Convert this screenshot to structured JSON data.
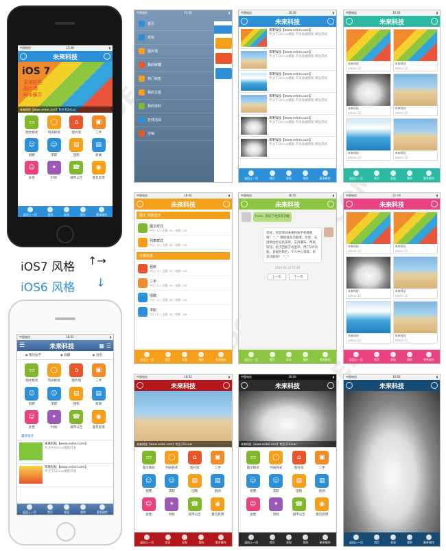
{
  "brand": "未来科技",
  "labels": {
    "ios7": "iOS7 风格",
    "ios6": "iOS6 风格"
  },
  "status": {
    "carrier": "中国电信",
    "t1": "15:48",
    "t2": "11:46",
    "t3": "16:28",
    "t4": "16:02",
    "t5": "16:05",
    "t6": "16:55",
    "t7": "21:19",
    "t8": "16:02",
    "t9": "16:09",
    "t10": "16:27",
    "t11": "16:02",
    "t12": "18:02"
  },
  "banner": {
    "big": "iOS 7",
    "l1": "无限配色",
    "l2": "图片墙",
    "l3": "App展示",
    "caption": "未来科技【www.veikei.com】专注于Discuz"
  },
  "grid": [
    "图文样式",
    "列表样式",
    "图片墙",
    "二手",
    "招聘",
    "求职",
    "团购",
    "新闻",
    "女性",
    "时尚",
    "城市公告",
    "意见反馈"
  ],
  "bottom": [
    "返回上一页",
    "首页",
    "发现",
    "我的",
    "更多操作"
  ],
  "menu": [
    "首页",
    "论坛",
    "图片墙",
    "我的收藏",
    "热门标签",
    "我的主题",
    "我的资料",
    "在线活动",
    "注销"
  ],
  "list": {
    "t": "未来科技【www.veikei.com】",
    "s": "专注于Discuz模板 开发高端模板 精品风格"
  },
  "wall": {
    "tag": "未来科技",
    "small": "admin",
    "num": "12"
  },
  "forum": {
    "sec1": "图文 列表显示",
    "sec2": "分类信息",
    "rows": [
      "图文样式",
      "列表样式",
      "租房",
      "二手",
      "招聘",
      "求职"
    ],
    "meta": "今日: 12 | 主题: 36 | 帖数: 108"
  },
  "chat": {
    "hello": "Hello, 测试了更多新功能",
    "msg": "您好，欢迎测试未来科技手机模板啦！^_^ 模板很多功能哦，比如：支持侧拉栏导航菜单，支持瀑布，帮助按钮，帖子回复方式显示，用户DIY功能，多级导航栏，个人中心等等，好多功能呀！ ^_^",
    "date": "2014-11-12 13:46",
    "prev": "上一页",
    "next": "下一页"
  },
  "ios6": {
    "tabs": [
      "我的帖子",
      "收藏",
      "消息"
    ],
    "recent": "最新亮点",
    "items": [
      {
        "t": "未来科技【www.veikei.com】",
        "s": "专注于Discuz模板开发"
      },
      {
        "t": "未来科技【www.veikei.com】",
        "s": "专注于Discuz模板开发"
      }
    ],
    "bottom": [
      "返回上一页",
      "首页",
      "发现",
      "我的",
      "更多操作"
    ]
  },
  "watermark": "DOWNCODE.COM",
  "colors": {
    "blue": "#2c8fd8",
    "teal": "#2bb9a1",
    "orange": "#f5a01b",
    "green": "#8cc540",
    "pink": "#e9437f",
    "red": "#b3161b",
    "dark": "#2b2b2b",
    "darkblue": "#164a73"
  }
}
